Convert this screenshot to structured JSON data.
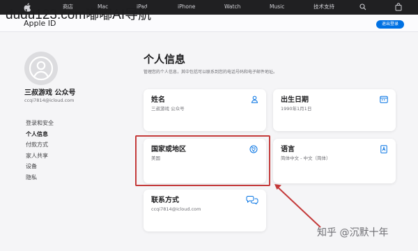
{
  "global_nav": {
    "items": [
      "商店",
      "Mac",
      "iPad",
      "iPhone",
      "Watch",
      "Music",
      "技术支持"
    ],
    "icons": [
      "apple-logo",
      "search-icon",
      "bag-icon"
    ],
    "background": "#202022"
  },
  "sub_nav": {
    "brand": "Apple ID",
    "signout_label": "退出登录"
  },
  "watermark": {
    "top": "dudu123.com嘟嘟AI导航",
    "bottom": "知乎 @沉默十年"
  },
  "profile": {
    "name": "三叔游戏 公众号",
    "email": "ccqi7814@icloud.com"
  },
  "sidebar": {
    "items": [
      {
        "label": "登录和安全",
        "active": false
      },
      {
        "label": "个人信息",
        "active": true
      },
      {
        "label": "付款方式",
        "active": false
      },
      {
        "label": "家人共享",
        "active": false
      },
      {
        "label": "设备",
        "active": false
      },
      {
        "label": "隐私",
        "active": false
      }
    ]
  },
  "main": {
    "title": "个人信息",
    "description": "管理您的个人信息，其中包括可以联系到您的电话号码和电子邮件地址。",
    "cards": {
      "name": {
        "title": "姓名",
        "value": "三叔游戏 公众号",
        "icon": "person-icon"
      },
      "birth": {
        "title": "出生日期",
        "value": "1990年1月1日",
        "icon": "calendar-icon"
      },
      "country": {
        "title": "国家或地区",
        "value": "美国",
        "icon": "globe-icon"
      },
      "language": {
        "title": "语言",
        "value": "简体中文 - 中文（简体）",
        "icon": "book-icon"
      },
      "contact": {
        "title": "联系方式",
        "value": "ccqi7814@icloud.com",
        "icon": "chat-bubbles-icon"
      }
    }
  },
  "colors": {
    "accent": "#0071e3",
    "highlight": "#c43a3a",
    "page_bg": "#f5f5f7"
  }
}
